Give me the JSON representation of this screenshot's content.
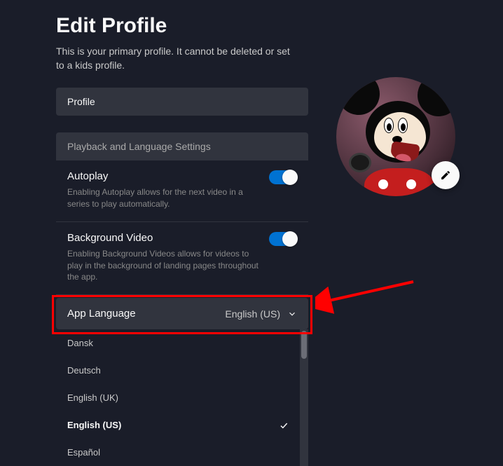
{
  "page": {
    "title": "Edit Profile",
    "subtitle": "This is your primary profile. It cannot be deleted or set to a kids profile."
  },
  "profile_name": "Profile",
  "section_header": "Playback and Language Settings",
  "settings": {
    "autoplay": {
      "title": "Autoplay",
      "desc": "Enabling Autoplay allows for the next video in a series to play automatically.",
      "on": true
    },
    "background_video": {
      "title": "Background Video",
      "desc": "Enabling Background Videos allows for videos to play in the background of landing pages throughout the app.",
      "on": true
    }
  },
  "app_language": {
    "label": "App Language",
    "value": "English (US)",
    "options": [
      "Dansk",
      "Deutsch",
      "English (UK)",
      "English (US)",
      "Español"
    ],
    "selected_index": 3
  },
  "avatar": {
    "character": "mickey-mouse"
  },
  "annotation": {
    "highlight_target": "app-language-dropdown",
    "color": "#ff0000"
  }
}
